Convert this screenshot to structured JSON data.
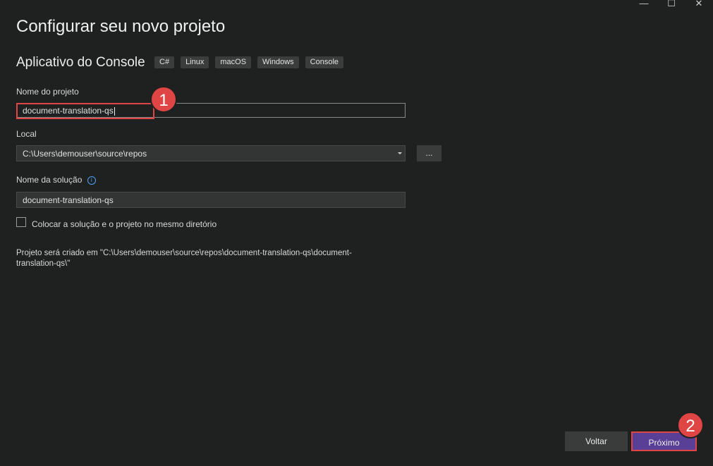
{
  "window_controls": {
    "minimize": "—",
    "maximize": "☐",
    "close": "✕"
  },
  "header": {
    "title": "Configurar seu novo projeto"
  },
  "template": {
    "name": "Aplicativo do Console",
    "tags": [
      "C#",
      "Linux",
      "macOS",
      "Windows",
      "Console"
    ]
  },
  "fields": {
    "project_name_label": "Nome do projeto",
    "project_name_value": "document-translation-qs",
    "location_label": "Local",
    "location_value": "C:\\Users\\demouser\\source\\repos",
    "browse_label": "...",
    "solution_name_label": "Nome da solução",
    "solution_name_value": "document-translation-qs",
    "same_dir_label": "Colocar a solução e o projeto no mesmo diretório",
    "same_dir_checked": false
  },
  "note": "Projeto será criado em \"C:\\Users\\demouser\\source\\repos\\document-translation-qs\\document-translation-qs\\\"",
  "buttons": {
    "back": "Voltar",
    "next": "Próximo"
  },
  "annotations": {
    "step1": "1",
    "step2": "2"
  },
  "colors": {
    "accent": "#5a3f96",
    "highlight": "#e04545",
    "background": "#1f2120"
  }
}
